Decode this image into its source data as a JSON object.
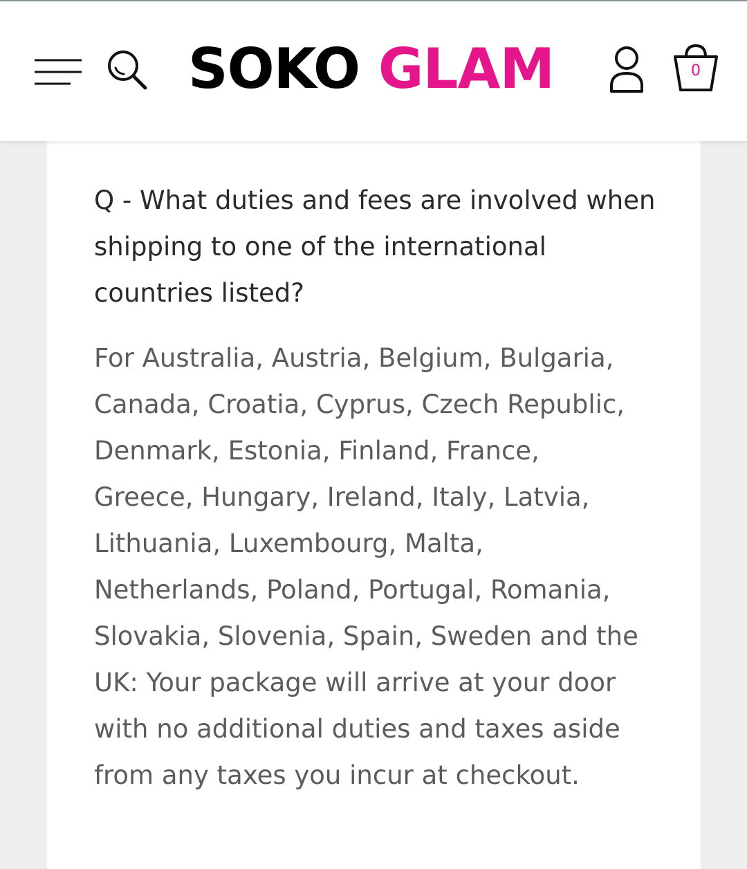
{
  "brand": {
    "name_part1": "SOKO",
    "name_part2": "GLAM",
    "accent_color": "#e5158b"
  },
  "header": {
    "menu_icon": "hamburger-menu-icon",
    "search_icon": "search-icon",
    "account_icon": "user-account-icon",
    "cart_icon": "shopping-bag-icon",
    "cart_count": "0"
  },
  "faq": {
    "question": "Q - What duties and fees are involved when shipping to one of the international countries listed?",
    "answer": "For Australia, Austria, Belgium, Bulgaria, Canada, Croatia, Cyprus, Czech Republic, Denmark, Estonia, Finland, France, Greece, Hungary, Ireland, Italy, Latvia, Lithuania, Luxembourg, Malta, Netherlands, Poland, Portugal, Romania, Slovakia, Slovenia, Spain, Sweden and the UK: Your package will arrive at your door with no additional duties and taxes aside from any taxes you incur at checkout."
  }
}
